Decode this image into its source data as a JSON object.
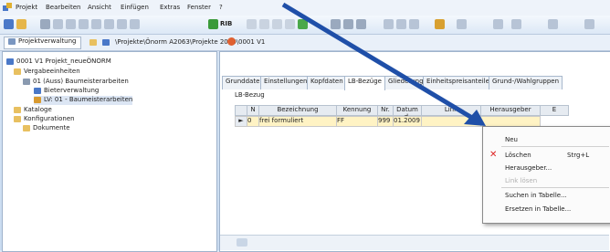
{
  "menu": {
    "items": [
      "Projekt",
      "Bearbeiten",
      "Ansicht",
      "Einfügen",
      "Extras",
      "Fenster",
      "?"
    ]
  },
  "toolbar": {
    "rib_label": "RIB"
  },
  "pathbar": {
    "tab_label": "Projektverwaltung",
    "path": "\\Projekte\\Önorm A2063\\Projekte 2010\\0001 V1"
  },
  "tree": {
    "items": [
      "0001 V1 Projekt_neueÖNORM",
      "Vergabeeinheiten",
      "01 (Auss) Baumeisterarbeiten",
      "Bieterverwaltung",
      "LV: 01 - Baumeisterarbeiten",
      "Kataloge",
      "Konfigurationen",
      "Dokumente"
    ]
  },
  "tabs": [
    "Grunddaten",
    "Einstellungen",
    "Kopfdaten",
    "LB-Bezüge",
    "Gliederung",
    "Einheitspreisanteile",
    "Grund-/Wahlgruppen"
  ],
  "grid": {
    "title": "LB-Bezug",
    "headers": [
      "N",
      "Bezeichnung",
      "Kennung",
      "Nr.",
      "Datum d.",
      "Link",
      "Herausgeber",
      "E"
    ],
    "row": [
      "0",
      "frei formuliert",
      "FF",
      "999",
      "01.2009",
      "",
      ""
    ]
  },
  "context_menu": {
    "items": [
      "Neu",
      "Löschen",
      "Herausgeber...",
      "Link lösen",
      "Suchen in Tabelle...",
      "Ersetzen in Tabelle..."
    ],
    "shortcut": "Strg+L"
  },
  "colors": {
    "arrow": "#1f4fa8",
    "selection": "#fff3c4",
    "delete_icon": "#d22"
  }
}
